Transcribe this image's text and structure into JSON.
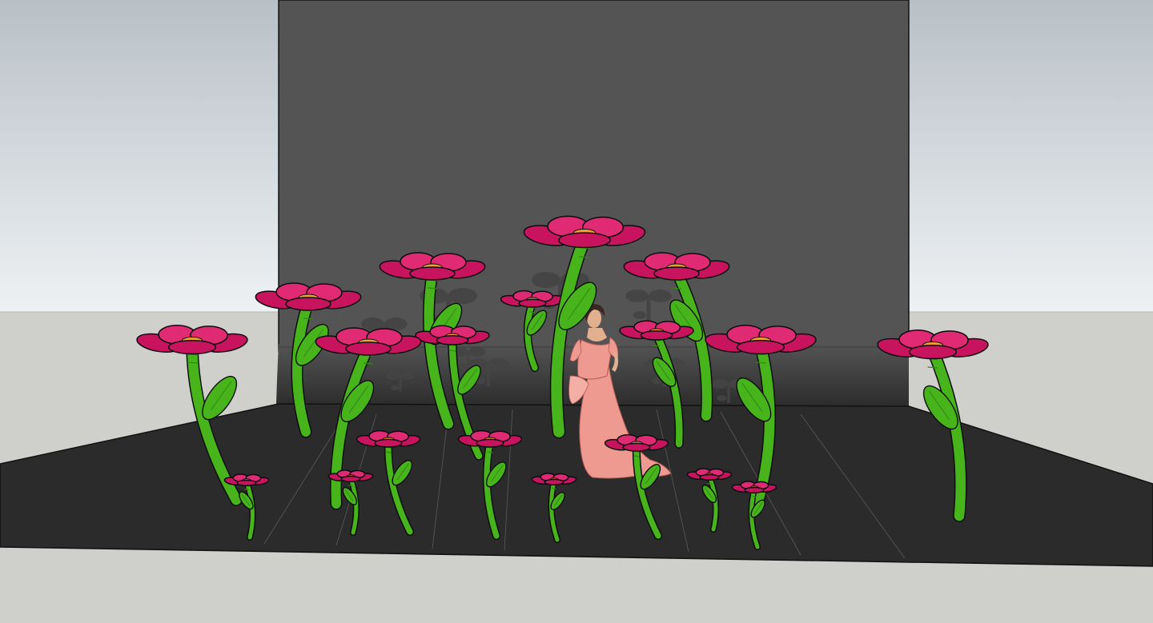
{
  "scene": {
    "colors": {
      "sky_top": "#b8c0c7",
      "sky_bottom": "#eef1f3",
      "ground": "#cfd0cc",
      "backdrop": "#545454",
      "floor": "#2b2b2b",
      "petal": "#c8145e",
      "petal_light": "#e02a73",
      "center": "#f0a030",
      "stem": "#48b41c",
      "stem_dark": "#2f8a12",
      "dress": "#ee9a90",
      "skin": "#e2b08f",
      "hair": "#3b2620",
      "outline": "#0e0e0e"
    },
    "elements": [
      "backdrop",
      "floor",
      "flower",
      "figure-woman-in-pink-dress"
    ]
  }
}
